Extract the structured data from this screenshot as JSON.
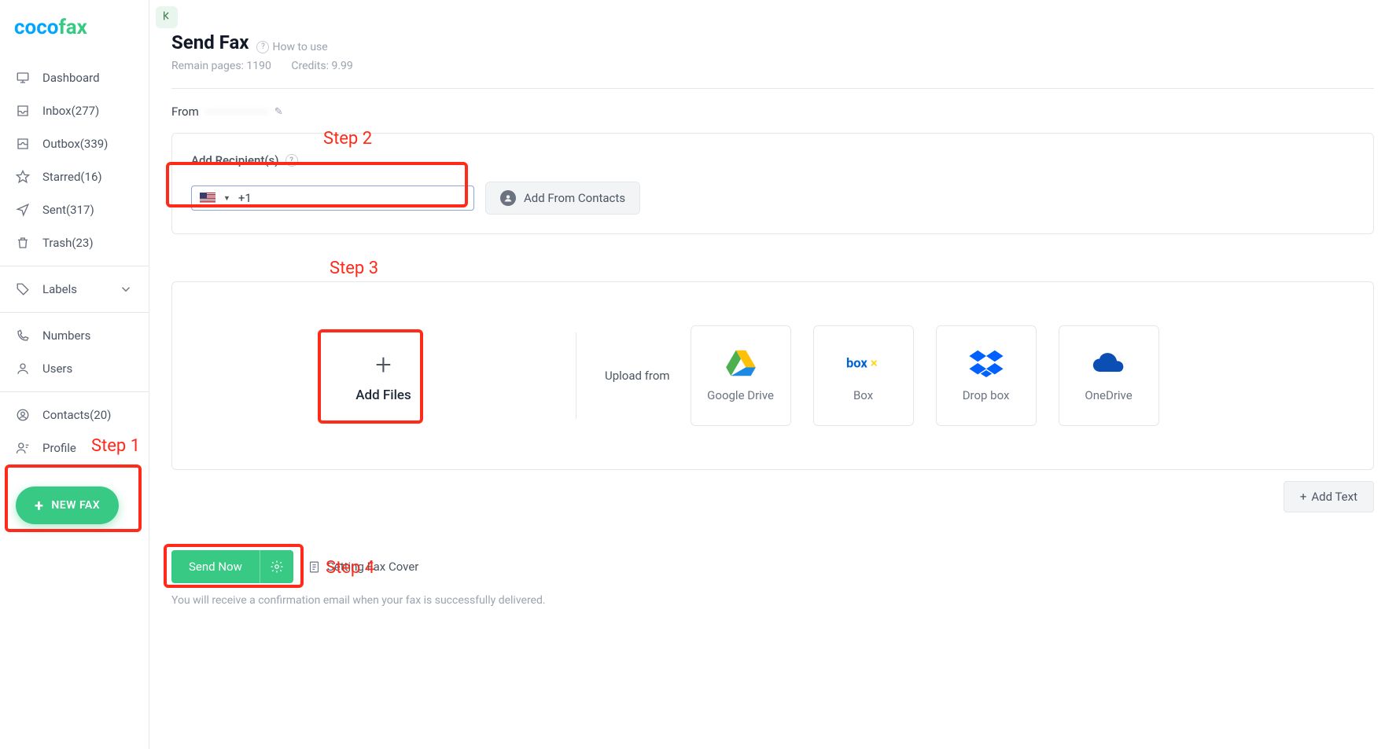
{
  "brand": {
    "part1": "coco",
    "part2": "fax"
  },
  "sidebar": {
    "items": [
      {
        "label": "Dashboard"
      },
      {
        "label": "Inbox(277)"
      },
      {
        "label": "Outbox(339)"
      },
      {
        "label": "Starred(16)"
      },
      {
        "label": "Sent(317)"
      },
      {
        "label": "Trash(23)"
      }
    ],
    "labels_label": "Labels",
    "numbers_label": "Numbers",
    "users_label": "Users",
    "contacts_label": "Contacts(20)",
    "profile_label": "Profile",
    "newfax_label": "NEW FAX"
  },
  "page": {
    "title": "Send Fax",
    "howto": "How to use",
    "remain": "Remain pages: 1190",
    "credits": "Credits: 9.99",
    "from_label": "From",
    "from_value": "",
    "recipients_label": "Add Recipient(s)",
    "phone_prefix": "+1",
    "add_from_contacts": "Add From Contacts",
    "add_files": "Add Files",
    "upload_from": "Upload from",
    "clouds": [
      {
        "name": "Google Drive"
      },
      {
        "name": "Box"
      },
      {
        "name": "Drop box"
      },
      {
        "name": "OneDrive"
      }
    ],
    "add_text": "Add Text",
    "send_now": "Send Now",
    "setting_cover": "Setting Fax Cover",
    "confirm_msg": "You will receive a confirmation email when your fax is successfully delivered."
  },
  "annotations": {
    "step1": "Step 1",
    "step2": "Step 2",
    "step3": "Step 3",
    "step4": "Step 4"
  }
}
